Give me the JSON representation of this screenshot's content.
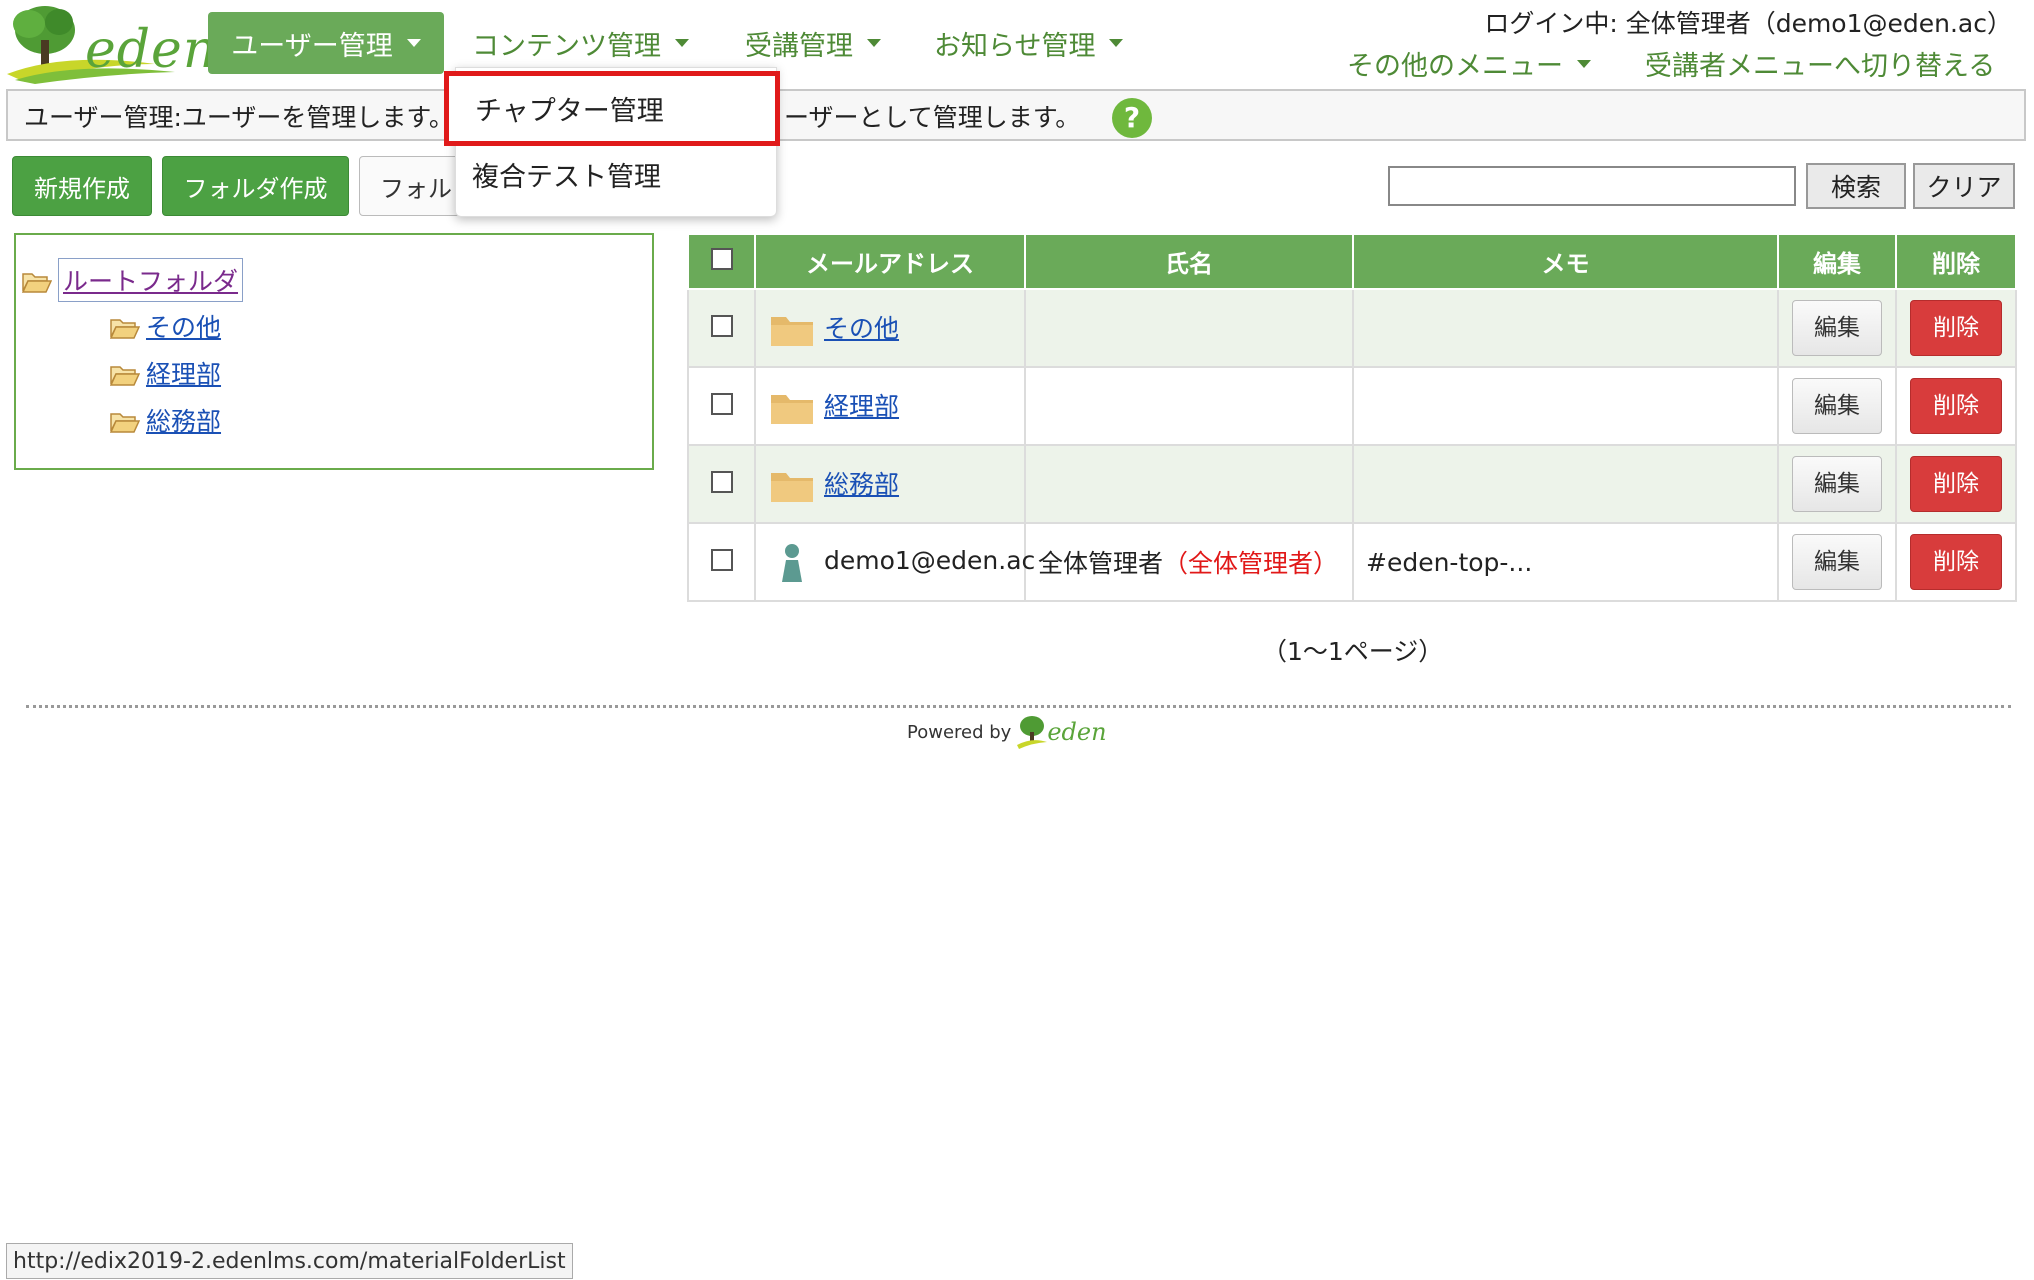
{
  "brand": {
    "logo_text": "eden",
    "powered_by": "Powered by",
    "powered_logo_text": "eden"
  },
  "nav": {
    "user": "ユーザー管理",
    "content": "コンテンツ管理",
    "course": "受講管理",
    "news": "お知らせ管理"
  },
  "header": {
    "login_info": "ログイン中: 全体管理者（demo1@eden.ac）",
    "other_menu": "その他のメニュー",
    "switch_menu": "受講者メニューへ切り替える"
  },
  "description": {
    "text_left": "ユーザー管理:ユーザーを管理します。",
    "text_right": "ーザーとして管理します。",
    "help_symbol": "?"
  },
  "dropdown": {
    "items": [
      "チャプター管理",
      "複合テスト管理"
    ],
    "highlighted_index": 0
  },
  "toolbar": {
    "new_label": "新規作成",
    "folder_label": "フォルダ作成",
    "folder2_label": "フォル",
    "search_value": "",
    "search_label": "検索",
    "clear_label": "クリア"
  },
  "tree": {
    "root": "ルートフォルダ",
    "children": [
      "その他",
      "経理部",
      "総務部"
    ]
  },
  "table": {
    "headers": {
      "email": "メールアドレス",
      "name": "氏名",
      "memo": "メモ",
      "edit": "編集",
      "delete": "削除"
    },
    "rows": [
      {
        "type": "folder",
        "email": "その他",
        "name": "",
        "name_role": "",
        "memo": "",
        "edit": "編集",
        "delete": "削除"
      },
      {
        "type": "folder",
        "email": "経理部",
        "name": "",
        "name_role": "",
        "memo": "",
        "edit": "編集",
        "delete": "削除"
      },
      {
        "type": "folder",
        "email": "総務部",
        "name": "",
        "name_role": "",
        "memo": "",
        "edit": "編集",
        "delete": "削除"
      },
      {
        "type": "user",
        "email": "demo1@eden.ac",
        "name": "全体管理者",
        "name_role": "（全体管理者）",
        "memo": "#eden-top-...",
        "edit": "編集",
        "delete": "削除"
      }
    ]
  },
  "pager": "（1～1ページ）",
  "status_url": "http://edix2019-2.edenlms.com/materialFolderList",
  "colors": {
    "accent_green": "#6aaa59",
    "link_blue": "#1a50b5",
    "delete_red": "#d83c3c",
    "highlight_red": "#e01a1a"
  }
}
